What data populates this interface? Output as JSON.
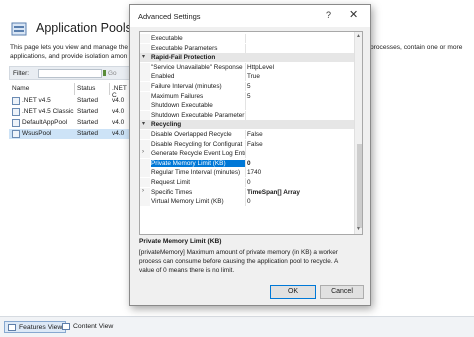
{
  "page": {
    "title": "Application Pools",
    "desc_line1": "This page lets you view and manage the l",
    "desc_line2": "applications, and provide isolation amon",
    "desc_right": "processes, contain one or more"
  },
  "filter": {
    "label": "Filter:",
    "go_label": "Go"
  },
  "columns": {
    "name": "Name",
    "status": "Status",
    "net": ".NET C"
  },
  "pools": [
    {
      "name": ".NET v4.5",
      "status": "Started",
      "net": "v4.0"
    },
    {
      "name": ".NET v4.5 Classic",
      "status": "Started",
      "net": "v4.0"
    },
    {
      "name": "DefaultAppPool",
      "status": "Started",
      "net": "v4.0"
    },
    {
      "name": "WsusPool",
      "status": "Started",
      "net": "v4.0"
    }
  ],
  "bottom_tabs": {
    "features": "Features View",
    "content": "Content View"
  },
  "dialog": {
    "title": "Advanced Settings",
    "help": "?",
    "close": "✕",
    "props": [
      {
        "name": "Executable",
        "value": ""
      },
      {
        "name": "Executable Parameters",
        "value": ""
      },
      {
        "name": "Rapid-Fail Protection",
        "value": "",
        "category": true
      },
      {
        "name": "\"Service Unavailable\" Response",
        "value": "HttpLevel"
      },
      {
        "name": "Enabled",
        "value": "True"
      },
      {
        "name": "Failure Interval (minutes)",
        "value": "5"
      },
      {
        "name": "Maximum Failures",
        "value": "5"
      },
      {
        "name": "Shutdown Executable",
        "value": ""
      },
      {
        "name": "Shutdown Executable Parameter",
        "value": ""
      },
      {
        "name": "Recycling",
        "value": "",
        "category": true
      },
      {
        "name": "Disable Overlapped Recycle",
        "value": "False"
      },
      {
        "name": "Disable Recycling for Configurat",
        "value": "False"
      },
      {
        "name": "Generate Recycle Event Log Entr",
        "value": "",
        "expandable": true
      },
      {
        "name": "Private Memory Limit (KB)",
        "value": "0",
        "selected": true
      },
      {
        "name": "Regular Time Interval (minutes)",
        "value": "1740"
      },
      {
        "name": "Request Limit",
        "value": "0"
      },
      {
        "name": "Specific Times",
        "value": "TimeSpan[] Array",
        "expandable": true,
        "bold_value": true
      },
      {
        "name": "Virtual Memory Limit (KB)",
        "value": "0"
      }
    ],
    "desc_title": "Private Memory Limit (KB)",
    "desc_lines": [
      "[privateMemory] Maximum amount of private memory (in KB) a worker",
      "process can consume before causing the application pool to recycle.  A",
      "value of 0 means there is no limit."
    ],
    "ok": "OK",
    "cancel": "Cancel"
  }
}
